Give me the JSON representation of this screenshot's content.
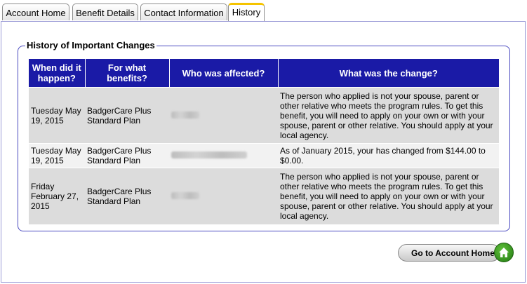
{
  "tabs": [
    {
      "label": "Account Home",
      "active": false
    },
    {
      "label": "Benefit Details",
      "active": false
    },
    {
      "label": "Contact Information",
      "active": false
    },
    {
      "label": "History",
      "active": true
    }
  ],
  "section": {
    "title": "History of Important Changes"
  },
  "table": {
    "headers": [
      "When did it happen?",
      "For what benefits?",
      "Who was affected?",
      "What was the change?"
    ],
    "rows": [
      {
        "date": "Tuesday May 19, 2015",
        "benefit": "BadgerCare Plus Standard Plan",
        "change": "The person who applied is not your spouse, parent or other relative who meets the program rules. To get this benefit, you will need to apply on your own or with your spouse, parent or other relative. You should apply at your local agency."
      },
      {
        "date": "Tuesday May 19, 2015",
        "benefit": "BadgerCare Plus Standard Plan",
        "change": "As of January 2015, your has changed from $144.00 to $0.00."
      },
      {
        "date": "Friday February 27, 2015",
        "benefit": "BadgerCare Plus Standard Plan",
        "change": "The person who applied is not your spouse, parent or other relative who meets the program rules. To get this benefit, you will need to apply on your own or with your spouse, parent or other relative. You should apply at your local agency."
      }
    ]
  },
  "home_button": {
    "label": "Go to Account Home",
    "icon": "home-icon"
  },
  "colors": {
    "header_bg": "#1a1aa6",
    "active_tab_accent": "#f5c400",
    "home_icon_green": "#2e8f1a"
  }
}
